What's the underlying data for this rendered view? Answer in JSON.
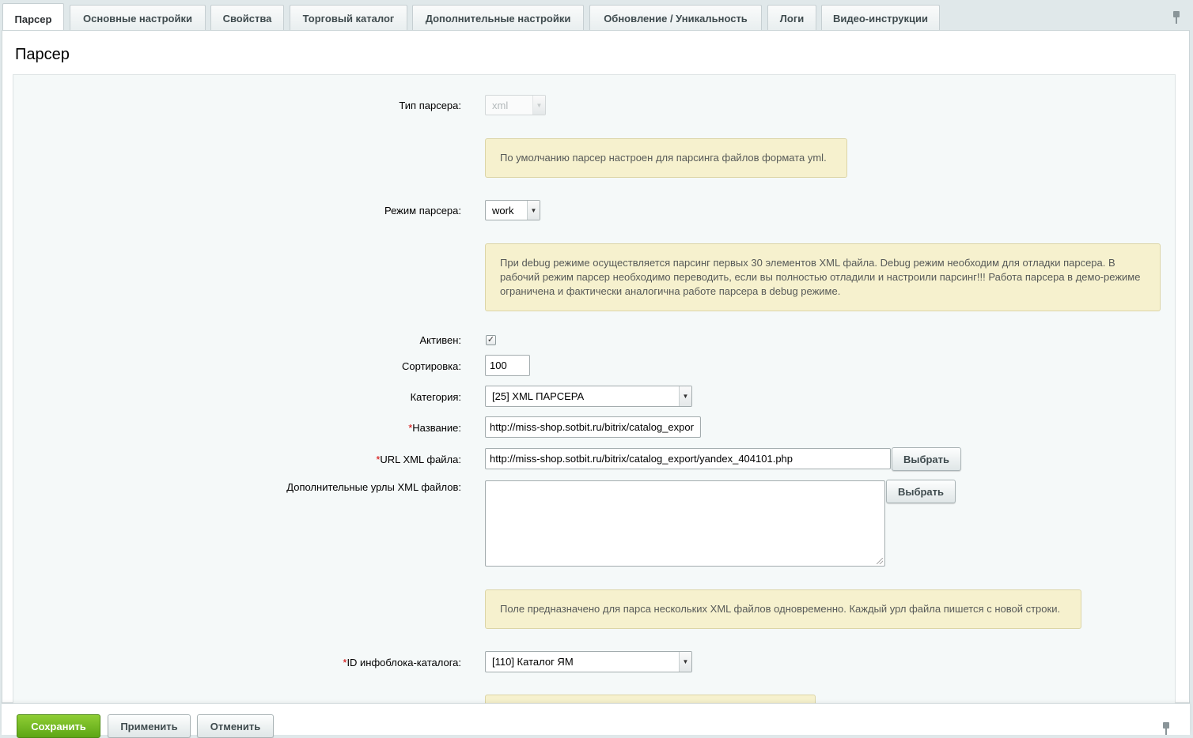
{
  "tabs": [
    {
      "label": "Парсер"
    },
    {
      "label": "Основные настройки"
    },
    {
      "label": "Свойства"
    },
    {
      "label": "Торговый каталог"
    },
    {
      "label": "Дополнительные настройки"
    },
    {
      "label": "Обновление / Уникальность"
    },
    {
      "label": "Логи"
    },
    {
      "label": "Видео-инструкции"
    }
  ],
  "active_tab": "Парсер",
  "page_title": "Парсер",
  "form": {
    "parser_type": {
      "label": "Тип парсера:",
      "value": "xml",
      "disabled": true
    },
    "parser_type_note": "По умолчанию парсер настроен для парсинга файлов формата yml.",
    "parser_mode": {
      "label": "Режим парсера:",
      "value": "work"
    },
    "parser_mode_note": "При debug режиме осуществляется парсинг первых 30 элементов XML файла. Debug режим необходим для отладки парсера. В рабочий режим парсер необходимо переводить, если вы полностью отладили и настроили парсинг!!! Работа парсера в демо-режиме ограничена и фактически аналогична работе парсера в debug режиме.",
    "active": {
      "label": "Активен:",
      "checked": true
    },
    "sort": {
      "label": "Сортировка:",
      "value": "100"
    },
    "category": {
      "label": "Категория:",
      "value": "[25] XML ПАРСЕРА"
    },
    "name": {
      "required_mark": "*",
      "label": "Название:",
      "value": "http://miss-shop.sotbit.ru/bitrix/catalog_expor"
    },
    "url_xml": {
      "required_mark": "*",
      "label": "URL XML файла:",
      "value": "http://miss-shop.sotbit.ru/bitrix/catalog_export/yandex_404101.php",
      "button": "Выбрать"
    },
    "extra_urls": {
      "label": "Дополнительные урлы XML файлов:",
      "value": "",
      "button": "Выбрать"
    },
    "extra_urls_note": "Поле предназначено для парса нескольких XML файлов одновременно. Каждый урл файла пишется с новой строки.",
    "iblock_id": {
      "required_mark": "*",
      "label": "ID инфоблока-каталога:",
      "value": "[110] Каталог ЯМ"
    }
  },
  "footer": {
    "save": "Сохранить",
    "apply": "Применить",
    "cancel": "Отменить"
  },
  "colors": {
    "save_button": "#6bb11e",
    "note_background": "#f6f1ce",
    "form_background": "#f5f9f9",
    "required_mark": "#d20000"
  },
  "icons": [
    "pin-icon",
    "chevron-down-icon",
    "check-icon"
  ]
}
